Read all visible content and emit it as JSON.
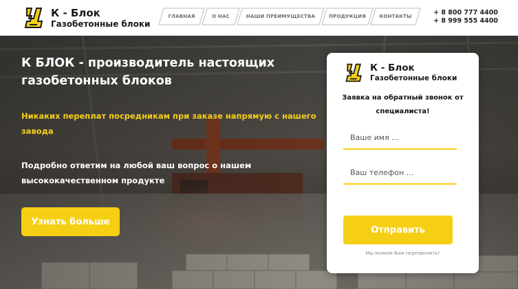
{
  "header": {
    "logo": {
      "title": "К - Блок",
      "subtitle": "Газобетонные блоки"
    },
    "nav": [
      {
        "label": "ГЛАВНАЯ"
      },
      {
        "label": "О НАС"
      },
      {
        "label": "НАШИ ПРЕИМУЩЕСТВА"
      },
      {
        "label": "ПРОДУКЦИЯ"
      },
      {
        "label": "КОНТАКТЫ"
      }
    ],
    "phones": [
      "+ 8 800 777 4400",
      "+ 8 999 555 4400"
    ]
  },
  "hero": {
    "title": "К БЛОК - производитель настоящих газобетонных блоков",
    "highlight": "Никаких переплат посредникам при заказе напрямую с нашего завода",
    "text": "Подробно ответим на любой ваш вопрос о нашем высококачественном продукте",
    "button": "Узнать больше"
  },
  "form": {
    "logo": {
      "title": "К - Блок",
      "subtitle": "Газобетонные блоки"
    },
    "heading": "Заявка на обратный звонок от специалиста!",
    "name_placeholder": "Ваше имя ...",
    "phone_placeholder": "Ваш телефон ...",
    "submit": "Отправить",
    "note": "Мы можем Вам перезвонить!"
  },
  "colors": {
    "accent": "#f6cf15",
    "text_dark": "#1a1a1a",
    "nav_text": "#6b6b6b"
  },
  "icons": {
    "logo": "k-block-logo-icon"
  }
}
